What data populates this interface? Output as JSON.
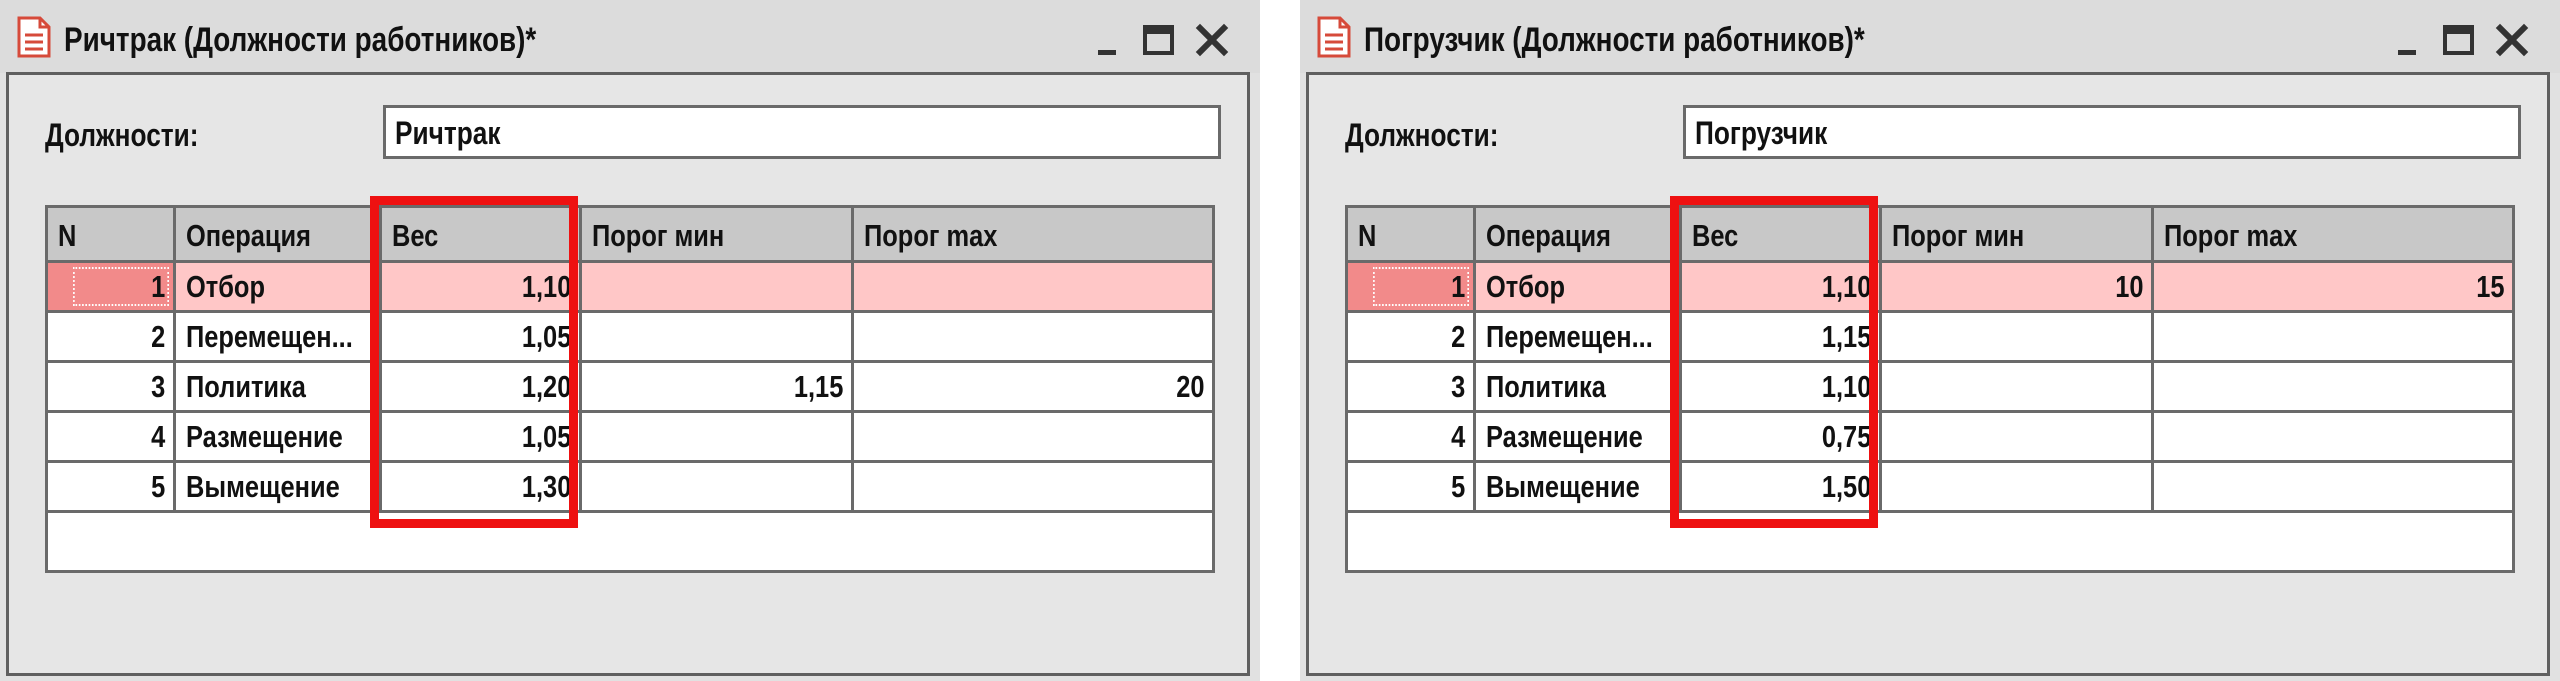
{
  "windows": [
    {
      "title": "Ричтрак (Должности работников)*",
      "field_label": "Должности:",
      "field_value": "Ричтрак",
      "columns": [
        "N",
        "Операция",
        "Вес",
        "Порог мин",
        "Порог max"
      ],
      "rows": [
        {
          "n": "1",
          "op": "Отбор",
          "weight": "1,10",
          "min": "",
          "max": ""
        },
        {
          "n": "2",
          "op": "Перемещен...",
          "weight": "1,05",
          "min": "",
          "max": ""
        },
        {
          "n": "3",
          "op": "Политика",
          "weight": "1,20",
          "min": "1,15",
          "max": "20"
        },
        {
          "n": "4",
          "op": "Размещение",
          "weight": "1,05",
          "min": "",
          "max": ""
        },
        {
          "n": "5",
          "op": "Вымещение",
          "weight": "1,30",
          "min": "",
          "max": ""
        }
      ]
    },
    {
      "title": "Погрузчик (Должности работников)*",
      "field_label": "Должности:",
      "field_value": "Погрузчик",
      "columns": [
        "N",
        "Операция",
        "Вес",
        "Порог мин",
        "Порог max"
      ],
      "rows": [
        {
          "n": "1",
          "op": "Отбор",
          "weight": "1,10",
          "min": "10",
          "max": "15"
        },
        {
          "n": "2",
          "op": "Перемещен...",
          "weight": "1,15",
          "min": "",
          "max": ""
        },
        {
          "n": "3",
          "op": "Политика",
          "weight": "1,10",
          "min": "",
          "max": ""
        },
        {
          "n": "4",
          "op": "Размещение",
          "weight": "0,75",
          "min": "",
          "max": ""
        },
        {
          "n": "5",
          "op": "Вымещение",
          "weight": "1,50",
          "min": "",
          "max": ""
        }
      ]
    }
  ],
  "colors": {
    "highlight": "#ee1111",
    "selected_row": "#ffc7c7",
    "selected_cell": "#f28a8a",
    "header_bg": "#c8c8c8",
    "window_bg": "#e1e1e1"
  },
  "icons": [
    "document-icon",
    "minimize-icon",
    "maximize-icon",
    "close-icon"
  ]
}
